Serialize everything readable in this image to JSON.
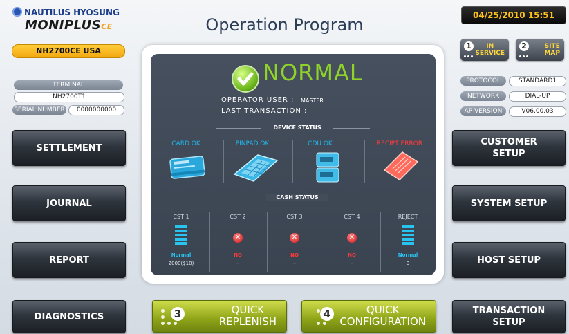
{
  "brand": {
    "company": "NAUTILUS HYOSUNG",
    "product": "MONIPLUS",
    "product_suffix": "CE",
    "model": "NH2700CE USA"
  },
  "header": {
    "title": "Operation Program",
    "datetime": "04/25/2010 15:51"
  },
  "mode_buttons": [
    {
      "num": "1",
      "line1": "IN",
      "line2": "SERVICE"
    },
    {
      "num": "2",
      "line1": "SITE",
      "line2": "MAP"
    }
  ],
  "left_info": {
    "terminal_label": "TERMINAL",
    "terminal_value": "NH2700T1",
    "serial_label": "SERIAL NUMBER",
    "serial_value": "0000000000"
  },
  "right_info": [
    {
      "label": "PROTOCOL",
      "value": "STANDARD1"
    },
    {
      "label": "NETWORK",
      "value": "DIAL-UP"
    },
    {
      "label": "AP VERSION",
      "value": "V06.00.03"
    }
  ],
  "left_buttons": [
    "SETTLEMENT",
    "JOURNAL",
    "REPORT",
    "DIAGNOSTICS"
  ],
  "right_buttons": [
    {
      "l1": "CUSTOMER",
      "l2": "SETUP"
    },
    {
      "l1": "SYSTEM SETUP",
      "l2": ""
    },
    {
      "l1": "HOST SETUP",
      "l2": ""
    },
    {
      "l1": "TRANSACTION",
      "l2": "SETUP"
    }
  ],
  "status": {
    "state": "NORMAL",
    "operator_label": "OPERATOR USER  :",
    "operator_value": "MASTER",
    "last_tx_label": "LAST TRANSACTION  :",
    "last_tx_value": ""
  },
  "device_status": {
    "title": "DEVICE STATUS",
    "devices": [
      {
        "label": "CARD OK",
        "error": false
      },
      {
        "label": "PINPAD OK",
        "error": false
      },
      {
        "label": "CDU OK",
        "error": false
      },
      {
        "label": "RECIPT ERROR",
        "error": true
      }
    ]
  },
  "cash_status": {
    "title": "CASH STATUS",
    "cassettes": [
      {
        "label": "CST 1",
        "status": "Normal",
        "amount": "2000($10)",
        "ok": true
      },
      {
        "label": "CST 2",
        "status": "NO",
        "amount": "--",
        "ok": false
      },
      {
        "label": "CST 3",
        "status": "NO",
        "amount": "--",
        "ok": false
      },
      {
        "label": "CST 4",
        "status": "NO",
        "amount": "--",
        "ok": false
      },
      {
        "label": "REJECT",
        "status": "Normal",
        "amount": "0",
        "ok": true
      }
    ]
  },
  "quick_buttons": [
    {
      "num": "3",
      "l1": "QUICK",
      "l2": "REPLENISH"
    },
    {
      "num": "4",
      "l1": "QUICK",
      "l2": "CONFIGURATION"
    }
  ],
  "colors": {
    "accent_yellow": "#ffc31c",
    "normal_green": "#8fd32a",
    "device_ok": "#22b4ea",
    "device_error": "#ff3c3c"
  }
}
